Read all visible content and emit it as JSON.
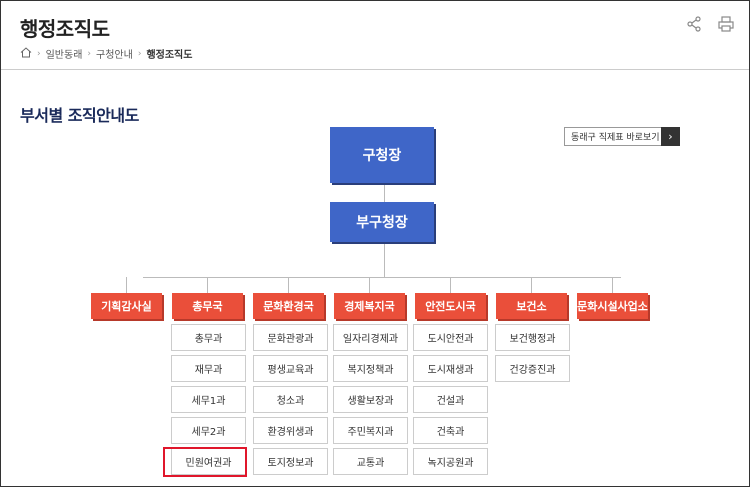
{
  "page_title": "행정조직도",
  "icons": [
    "share-icon",
    "print-icon",
    "home-icon"
  ],
  "breadcrumb": [
    "일반동래",
    "구청안내",
    "행정조직도"
  ],
  "section_title": "부서별 조직안내도",
  "org_chart_link": "동래구 직제표 바로보기",
  "head1": "구청장",
  "head2": "부구청장",
  "departments": [
    {
      "name": "기획감사실",
      "teams": []
    },
    {
      "name": "총무국",
      "teams": [
        "총무과",
        "재무과",
        "세무1과",
        "세무2과",
        "민원여권과"
      ]
    },
    {
      "name": "문화환경국",
      "teams": [
        "문화관광과",
        "평생교육과",
        "청소과",
        "환경위생과",
        "토지정보과"
      ]
    },
    {
      "name": "경제복지국",
      "teams": [
        "일자리경제과",
        "복지정책과",
        "생활보장과",
        "주민복지과",
        "교통과"
      ]
    },
    {
      "name": "안전도시국",
      "teams": [
        "도시안전과",
        "도시재생과",
        "건설과",
        "건축과",
        "녹지공원과"
      ]
    },
    {
      "name": "보건소",
      "teams": [
        "보건행정과",
        "건강증진과"
      ]
    },
    {
      "name": "문화시설사업소",
      "teams": []
    }
  ],
  "colors": {
    "blue": "#3f66c8",
    "dept_red": "#ea4f3a",
    "highlight_red": "#e0162b"
  }
}
